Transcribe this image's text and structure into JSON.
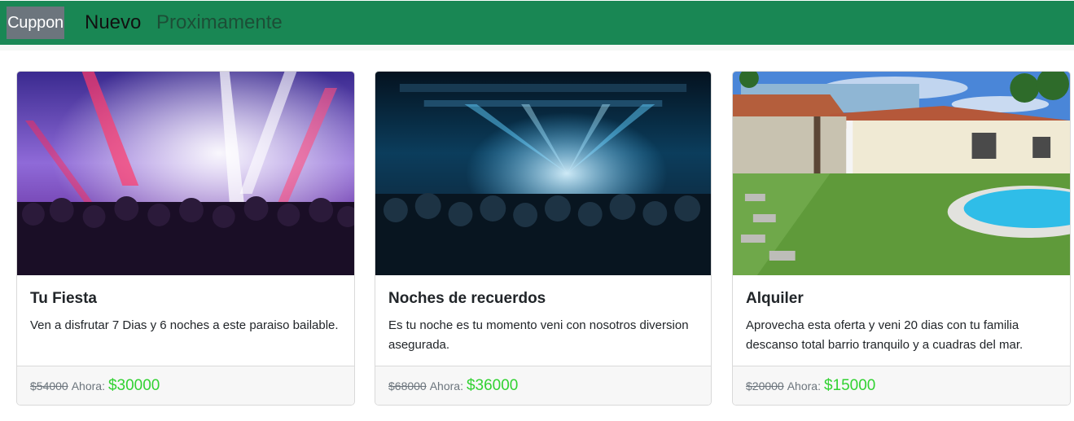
{
  "navbar": {
    "brand": "Cuppon",
    "links": [
      {
        "label": "Nuevo"
      },
      {
        "label": "Proximamente"
      }
    ]
  },
  "cards": [
    {
      "title": "Tu Fiesta",
      "text": "Ven a disfrutar 7 Dias y 6 noches a este paraiso bailable.",
      "old_price": "$54000",
      "now_label": "Ahora:",
      "new_price": "$30000"
    },
    {
      "title": "Noches de recuerdos",
      "text": "Es tu noche es tu momento veni con nosotros diversion asegurada.",
      "old_price": "$68000",
      "now_label": "Ahora:",
      "new_price": "$36000"
    },
    {
      "title": "Alquiler",
      "text": "Aprovecha esta oferta y veni 20 dias con tu familia descanso total barrio tranquilo y a cuadras del mar.",
      "old_price": "$20000",
      "now_label": "Ahora:",
      "new_price": "$15000"
    }
  ],
  "colors": {
    "navbar": "#198754",
    "brand_bg": "#6c757d",
    "price_new": "#32d232"
  }
}
